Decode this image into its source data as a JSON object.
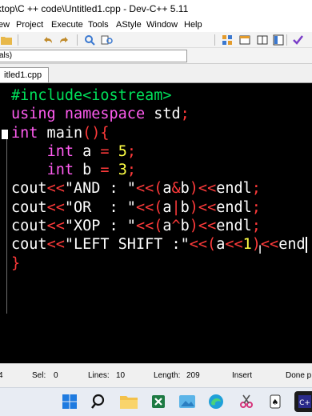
{
  "window": {
    "title": "ktop\\C ++ code\\Untitled1.cpp - Dev-C++ 5.11"
  },
  "menu": [
    "ew",
    "Project",
    "Execute",
    "Tools",
    "AStyle",
    "Window",
    "Help"
  ],
  "toolbar": {
    "icons": [
      "open-folder-icon",
      "undo-icon",
      "redo-icon",
      "find-icon",
      "replace-icon",
      "grid-icon",
      "window-icon",
      "columns-icon",
      "panels-icon",
      "check-icon"
    ]
  },
  "combo": {
    "value": "als)"
  },
  "tab": {
    "label": "itled1.cpp"
  },
  "code_lines": [
    [
      [
        "pre",
        "#include<iostream>"
      ]
    ],
    [
      [
        "kw",
        "using"
      ],
      [
        "plain",
        " "
      ],
      [
        "kw",
        "namespace"
      ],
      [
        "plain",
        " std"
      ],
      [
        "op",
        ";"
      ]
    ],
    [
      [
        "kw",
        "int"
      ],
      [
        "plain",
        " main"
      ],
      [
        "op",
        "(){"
      ]
    ],
    [
      [
        "plain",
        "    "
      ],
      [
        "kw",
        "int"
      ],
      [
        "plain",
        " a "
      ],
      [
        "op",
        "="
      ],
      [
        "plain",
        " "
      ],
      [
        "num",
        "5"
      ],
      [
        "op",
        ";"
      ]
    ],
    [
      [
        "plain",
        "    "
      ],
      [
        "kw",
        "int"
      ],
      [
        "plain",
        " b "
      ],
      [
        "op",
        "="
      ],
      [
        "plain",
        " "
      ],
      [
        "num",
        "3"
      ],
      [
        "op",
        ";"
      ]
    ],
    [
      [
        "plain",
        "cout"
      ],
      [
        "op",
        "<<"
      ],
      [
        "str",
        "\"AND : \""
      ],
      [
        "op",
        "<<("
      ],
      [
        "plain",
        "a"
      ],
      [
        "op",
        "&"
      ],
      [
        "plain",
        "b"
      ],
      [
        "op",
        ")<<"
      ],
      [
        "plain",
        "endl"
      ],
      [
        "op",
        ";"
      ]
    ],
    [
      [
        "plain",
        "cout"
      ],
      [
        "op",
        "<<"
      ],
      [
        "str",
        "\"OR  : \""
      ],
      [
        "op",
        "<<("
      ],
      [
        "plain",
        "a"
      ],
      [
        "op",
        "|"
      ],
      [
        "plain",
        "b"
      ],
      [
        "op",
        ")<<"
      ],
      [
        "plain",
        "endl"
      ],
      [
        "op",
        ";"
      ]
    ],
    [
      [
        "plain",
        "cout"
      ],
      [
        "op",
        "<<"
      ],
      [
        "str",
        "\"XOP : \""
      ],
      [
        "op",
        "<<("
      ],
      [
        "plain",
        "a"
      ],
      [
        "op",
        "^"
      ],
      [
        "plain",
        "b"
      ],
      [
        "op",
        ")<<"
      ],
      [
        "plain",
        "endl"
      ],
      [
        "op",
        ";"
      ]
    ],
    [
      [
        "plain",
        "cout"
      ],
      [
        "op",
        "<<"
      ],
      [
        "str",
        "\"LEFT SHIFT :\""
      ],
      [
        "op",
        "<<("
      ],
      [
        "plain",
        "a"
      ],
      [
        "op",
        "<<"
      ],
      [
        "num",
        "1"
      ],
      [
        "op",
        ")<<"
      ],
      [
        "plain",
        "end"
      ]
    ],
    [
      [
        "op",
        "}"
      ]
    ]
  ],
  "status": {
    "line_col": "4",
    "sel_label": "Sel:",
    "sel_value": "0",
    "lines_label": "Lines:",
    "lines_value": "10",
    "length_label": "Length:",
    "length_value": "209",
    "mode": "Insert",
    "message": "Done p"
  },
  "taskbar": {
    "icons": [
      "windows-start-icon",
      "search-icon",
      "file-explorer-icon",
      "excel-icon",
      "photos-icon",
      "edge-icon",
      "snipping-tool-icon",
      "solitaire-icon",
      "devcpp-icon"
    ]
  },
  "colors": {
    "editor_bg": "#000000",
    "preprocessor": "#00e05a",
    "keyword": "#ff5cf0",
    "operator": "#ff3a3a",
    "number": "#ffff44",
    "text": "#ffffff"
  }
}
